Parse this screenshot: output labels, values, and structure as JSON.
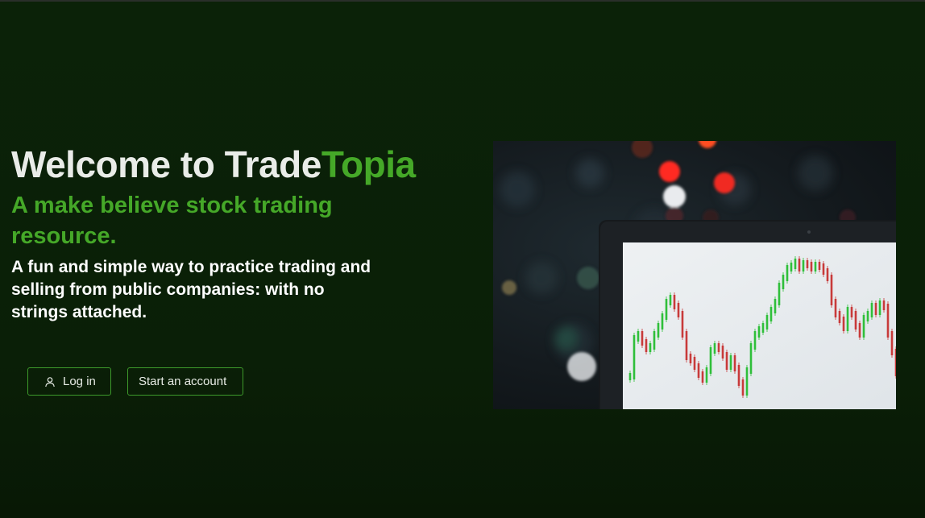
{
  "hero": {
    "title_prefix": "Welcome to Trade",
    "title_accent": "Topia",
    "subtitle": "A make believe stock trading resource.",
    "description": "A fun and simple way to practice trading and selling from public companies: with no strings attached."
  },
  "buttons": {
    "login_label": "Log in",
    "start_label": "Start an account"
  },
  "icons": {
    "login_icon": "user-icon"
  },
  "colors": {
    "background": "#0a1f07",
    "accent": "#45a828",
    "button_border": "#3d9a2b",
    "text_primary": "#e9ece8"
  }
}
